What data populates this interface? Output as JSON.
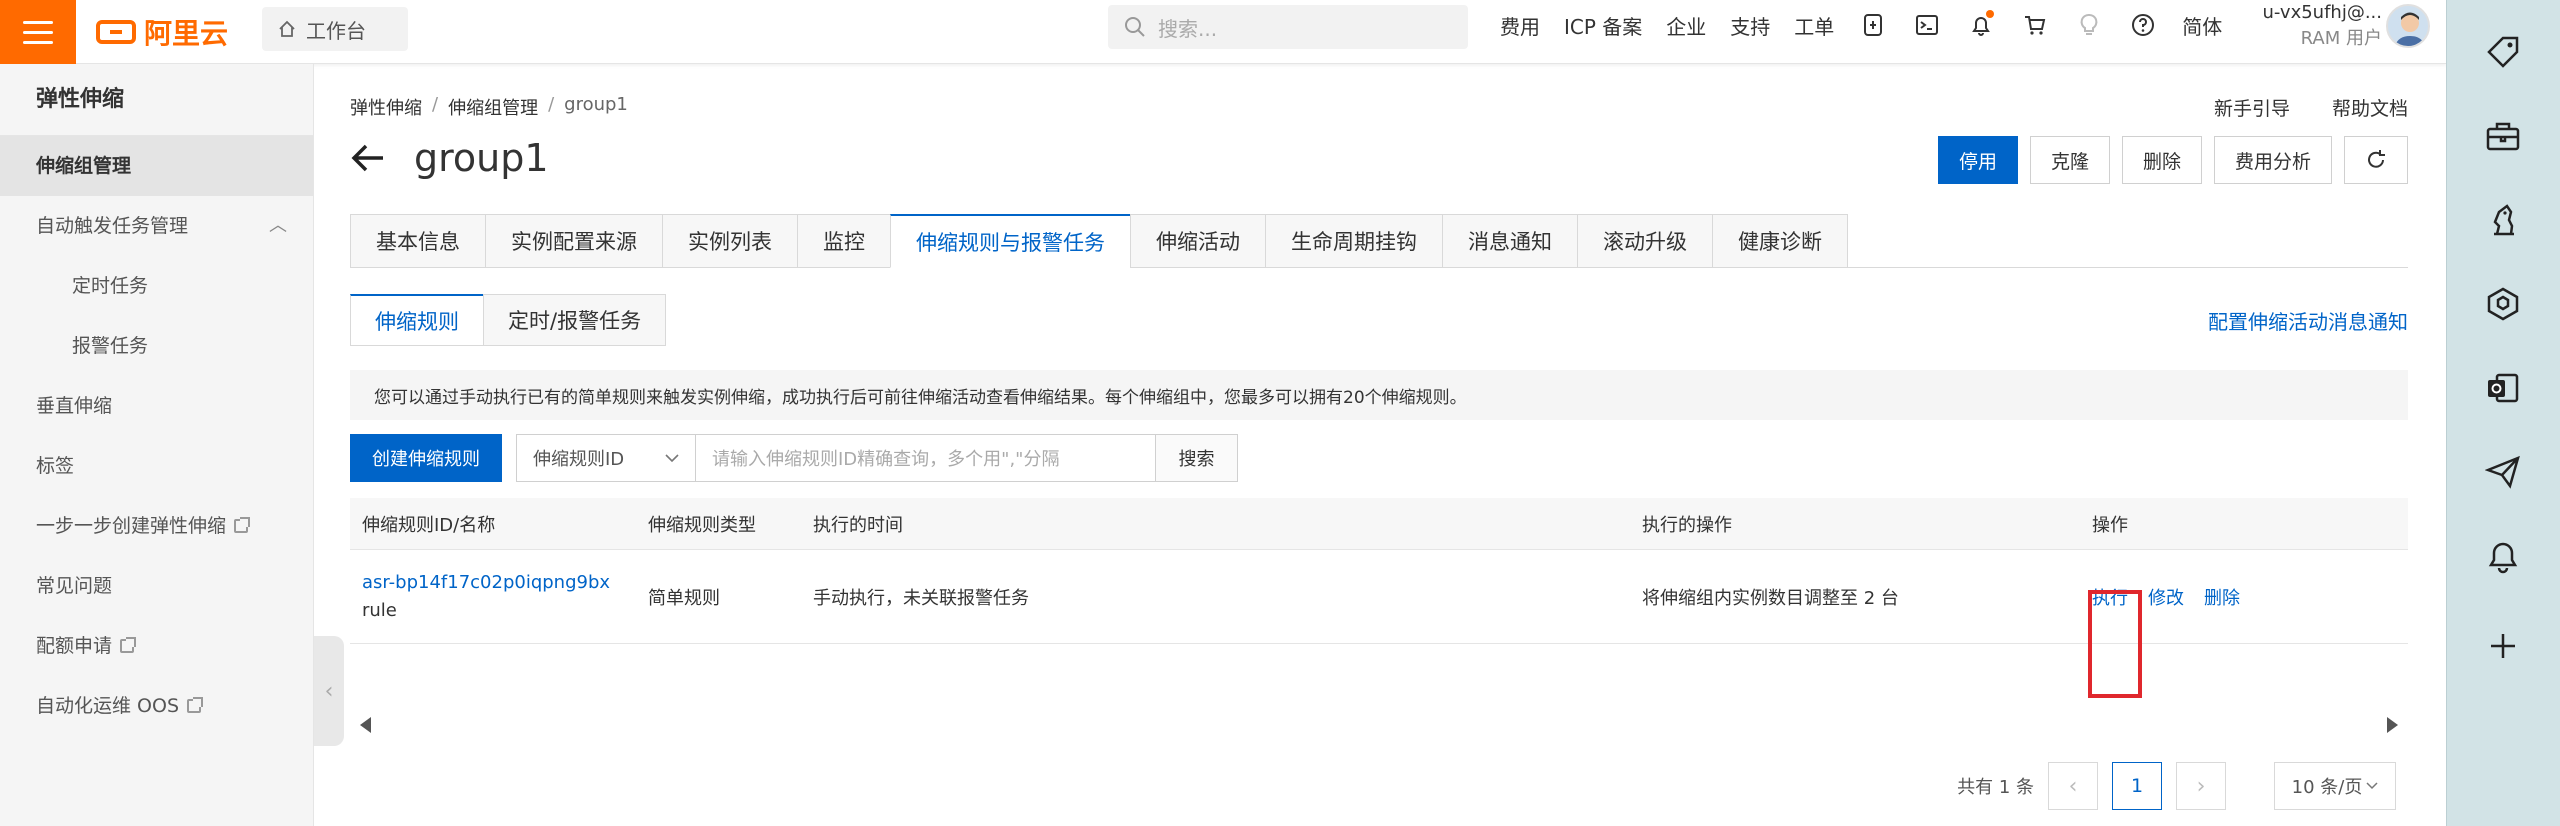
{
  "topbar": {
    "brand": "阿里云",
    "workbench": "工作台",
    "search_placeholder": "搜索...",
    "nav": [
      "费用",
      "ICP 备案",
      "企业",
      "支持",
      "工单"
    ],
    "language": "简体",
    "user_name": "u-vx5ufhj@...",
    "user_role": "RAM 用户"
  },
  "sidebar": {
    "title": "弹性伸缩",
    "items": [
      {
        "label": "伸缩组管理"
      },
      {
        "label": "自动触发任务管理"
      },
      {
        "label": "定时任务"
      },
      {
        "label": "报警任务"
      },
      {
        "label": "垂直伸缩"
      },
      {
        "label": "标签"
      },
      {
        "label": "一步一步创建弹性伸缩"
      },
      {
        "label": "常见问题"
      },
      {
        "label": "配额申请"
      },
      {
        "label": "自动化运维 OOS"
      }
    ]
  },
  "breadcrumb": [
    "弹性伸缩",
    "伸缩组管理",
    "group1"
  ],
  "help_links": {
    "guide": "新手引导",
    "docs": "帮助文档"
  },
  "page_title": "group1",
  "header_buttons": {
    "disable": "停用",
    "clone": "克隆",
    "delete": "删除",
    "cost": "费用分析"
  },
  "tabs": [
    "基本信息",
    "实例配置来源",
    "实例列表",
    "监控",
    "伸缩规则与报警任务",
    "伸缩活动",
    "生命周期挂钩",
    "消息通知",
    "滚动升级",
    "健康诊断"
  ],
  "subtabs": [
    "伸缩规则",
    "定时/报警任务"
  ],
  "notify_link": "配置伸缩活动消息通知",
  "notice": "您可以通过手动执行已有的简单规则来触发实例伸缩，成功执行后可前往伸缩活动查看伸缩结果。每个伸缩组中，您最多可以拥有20个伸缩规则。",
  "toolbar": {
    "create": "创建伸缩规则",
    "filter_select": "伸缩规则ID",
    "query_placeholder": "请输入伸缩规则ID精确查询，多个用\",\"分隔",
    "search": "搜索"
  },
  "table": {
    "headers": [
      "伸缩规则ID/名称",
      "伸缩规则类型",
      "执行的时间",
      "执行的操作",
      "操作"
    ],
    "rows": [
      {
        "id": "asr-bp14f17c02p0iqpng9bx",
        "name": "rule",
        "type": "简单规则",
        "time": "手动执行，未关联报警任务",
        "action": "将伸缩组内实例数目调整至 2 台",
        "ops": [
          "执行",
          "修改",
          "删除"
        ]
      }
    ]
  },
  "pagination": {
    "total": "共有 1 条",
    "current": "1",
    "page_size": "10 条/页"
  },
  "colors": {
    "accent": "#0064c8",
    "brand": "#ff6a00",
    "highlight": "#e0272d"
  }
}
